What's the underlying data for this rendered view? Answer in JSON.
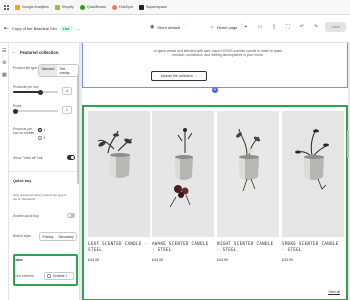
{
  "bookmarks": [
    {
      "label": "Google Analytics",
      "color": "#f4a31f"
    },
    {
      "label": "Shopify",
      "color": "#95bf47"
    },
    {
      "label": "QuickBooks",
      "color": "#2ca01c"
    },
    {
      "label": "HubSpot",
      "color": "#ff7a59"
    },
    {
      "label": "Squarespace",
      "color": "#222222"
    }
  ],
  "toolbar": {
    "theme_name": "Copy of the Baseline 24h",
    "live_label": "Live",
    "ellipsis": "...",
    "store_default": "Store default",
    "home_page": "Home page",
    "save_label": "Save"
  },
  "panel": {
    "title": "Featured collection",
    "product_tile_type_label": "Product tile type",
    "tile_options": [
      "Standard",
      "Text overlay"
    ],
    "products_per_row_label": "Products per row",
    "products_per_row_value": "4",
    "products_per_row_fraction": 0.6,
    "rows_label": "Rows",
    "rows_value": "1",
    "rows_fraction": 0.05,
    "products_per_row_mobile_label": "Products per row on mobile",
    "mobile_options": [
      "1",
      "2"
    ],
    "show_view_all_label": "Show \"View all\" link",
    "quick_buy_heading": "Quick buy",
    "quick_buy_help": "Only supported when product tile type is set to \"Standard\".",
    "enable_quick_buy_label": "Enable quick buy",
    "button_style_label": "Button style",
    "button_style_options": [
      "Primary",
      "Secondary"
    ],
    "color_heading": "Color",
    "color_scheme_label": "Color scheme",
    "color_scheme_value": "Scheme 7"
  },
  "preview": {
    "intro_text": "or glass vessel and blended with care, each KOSOS scented candle is made to spark emotion, connection, and inviting atmospheres in your home.",
    "explore_label": "explore the collection →",
    "products": [
      {
        "title": "LEAF SCENTED CANDLE - STEEL",
        "price": "£44.99"
      },
      {
        "title": "AWAKE SCENTED CANDLE - STEEL",
        "price": "£44.99"
      },
      {
        "title": "NIGHT SCENTED CANDLE - STEEL",
        "price": "£44.99"
      },
      {
        "title": "SMOKE SCENTED CANDLE - STEEL",
        "price": "£44.99"
      }
    ],
    "view_all": "View all"
  }
}
